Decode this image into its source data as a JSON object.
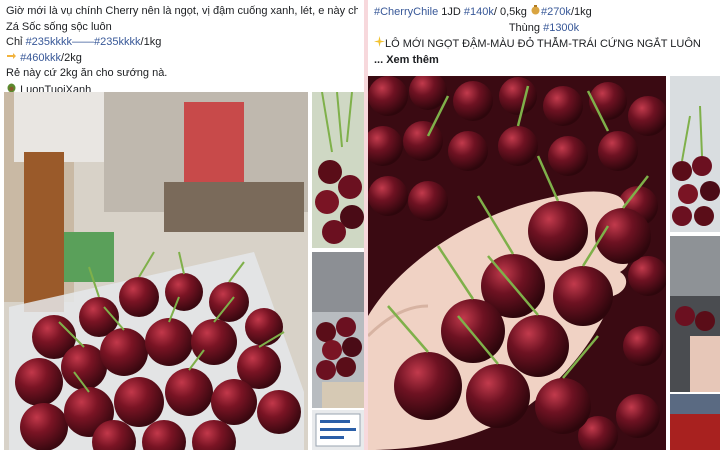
{
  "left_post": {
    "line1": "Giờ mới là vụ chính Cherry nên là ngọt, vị đậm cuống xanh, lét, e này chân dài mi",
    "line2": "Zá Sốc sống sộc luôn",
    "line3_prefix": "Chỉ ",
    "line3_tag1": "#235kkkk",
    "line3_sep": "——",
    "line3_tag2": "#235kkkk",
    "line3_suffix": "/1kg",
    "line4_icon": "point-right-icon",
    "line4_tag": "#460kkk",
    "line4_suffix": "/2kg",
    "line5": "Rẻ này cứ 2kg ăn cho sướng nà.",
    "line6_icon": "avocado-icon",
    "line6": "LuonTuoiXanh"
  },
  "right_post": {
    "line1_tag1": "#CherryChile",
    "line1_mid": " 1JD ",
    "line1_tag2": "#140k",
    "line1_mid2": "/ 0,5kg  ",
    "line1_icon": "money-bag-icon",
    "line1_tag3": "#270k",
    "line1_suffix": "/1kg",
    "line2_prefix": "Thùng ",
    "line2_tag": "#1300k",
    "line3_icon": "sparkles-icon",
    "line3": "LÔ MỚI NGỌT ĐẬM-MÀU ĐỎ THẪM-TRÁI CỨNG NGẮT LUÔN",
    "see_more": "... Xem thêm"
  },
  "colors": {
    "background": "#f7d8dc",
    "hashtag": "#385898",
    "text": "#1c1e21",
    "cherry_dark": "#4a0b16",
    "cherry_mid": "#7a1424",
    "stem_green": "#7fb04a"
  }
}
